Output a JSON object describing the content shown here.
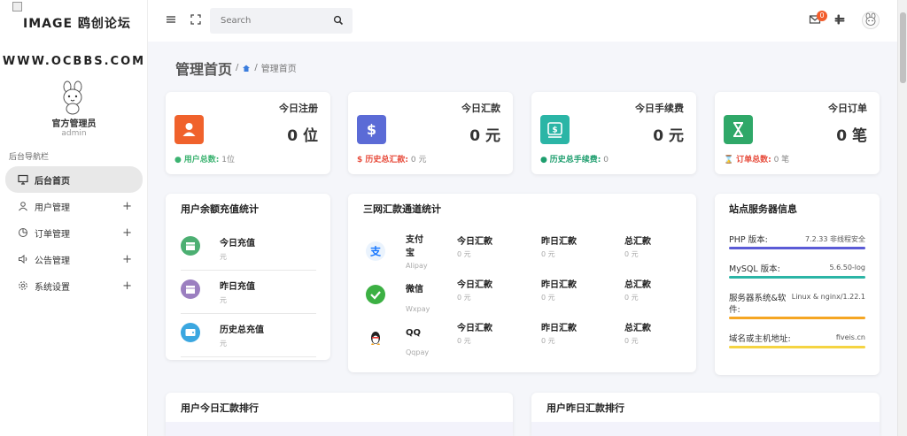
{
  "logo": {
    "text": "IMAGE 鸥创论坛"
  },
  "sidebar": {
    "site_url": "WWW.OCBBS.COM",
    "admin_name": "官方管理员",
    "admin_role": "admin",
    "nav_title": "后台导航栏",
    "items": [
      {
        "label": "后台首页",
        "icon": "monitor-icon",
        "active": true
      },
      {
        "label": "用户管理",
        "icon": "user-icon",
        "expandable": true
      },
      {
        "label": "订单管理",
        "icon": "pie-chart-icon",
        "expandable": true
      },
      {
        "label": "公告管理",
        "icon": "speaker-icon",
        "expandable": true
      },
      {
        "label": "系统设置",
        "icon": "gear-icon",
        "expandable": true
      }
    ],
    "expand_symbol": "+"
  },
  "topbar": {
    "search_placeholder": "Search",
    "mail_badge": "0"
  },
  "page": {
    "title": "管理首页",
    "breadcrumb_sep": "/",
    "breadcrumb_current": "管理首页"
  },
  "stats": [
    {
      "title": "今日注册",
      "value": "0 位",
      "foot_label": "用户总数:",
      "foot_value": "1位",
      "color": "#f0622c",
      "foot_color": "#3cb371"
    },
    {
      "title": "今日汇款",
      "value": "0 元",
      "foot_label": "$ 历史总汇款:",
      "foot_value": "0 元",
      "color": "#5b6bd6",
      "foot_color": "#e74c3c"
    },
    {
      "title": "今日手续费",
      "value": "0 元",
      "foot_label": "历史总手续费:",
      "foot_value": "0",
      "color": "#2bb5a6",
      "foot_color": "#1e9e6e"
    },
    {
      "title": "今日订单",
      "value": "0 笔",
      "foot_label": "订单总数:",
      "foot_value": "0 笔",
      "color": "#2fa868",
      "foot_color": "#e74c3c"
    }
  ],
  "recharge": {
    "title": "用户余额充值统计",
    "rows": [
      {
        "label": "今日充值",
        "unit": "元"
      },
      {
        "label": "昨日充值",
        "unit": "元"
      },
      {
        "label": "历史总充值",
        "unit": "元"
      }
    ]
  },
  "channels": {
    "title": "三网汇款通道统计",
    "cols": [
      "今日汇款",
      "昨日汇款",
      "总汇款"
    ],
    "rows": [
      {
        "name": "支付宝",
        "sub": "Alipay",
        "values": [
          "0 元",
          "0 元",
          "0 元"
        ]
      },
      {
        "name": "微信",
        "sub": "Wxpay",
        "values": [
          "0 元",
          "0 元",
          "0 元"
        ]
      },
      {
        "name": "QQ",
        "sub": "Qqpay",
        "values": [
          "0 元",
          "0 元",
          "0 元"
        ]
      }
    ]
  },
  "server": {
    "title": "站点服务器信息",
    "rows": [
      {
        "key": "PHP 版本:",
        "value": "7.2.33 非线程安全",
        "color": "#5b5bd6"
      },
      {
        "key": "MySQL 版本:",
        "value": "5.6.50-log",
        "color": "#2bb5a6"
      },
      {
        "key": "服务器系统&软件:",
        "value": "Linux & nginx/1.22.1",
        "color": "#f5a623"
      },
      {
        "key": "域名或主机地址:",
        "value": "fiveis.cn",
        "color": "#f5d442"
      }
    ]
  },
  "ranking": {
    "today_title": "用户今日汇款排行",
    "yesterday_title": "用户昨日汇款排行"
  }
}
